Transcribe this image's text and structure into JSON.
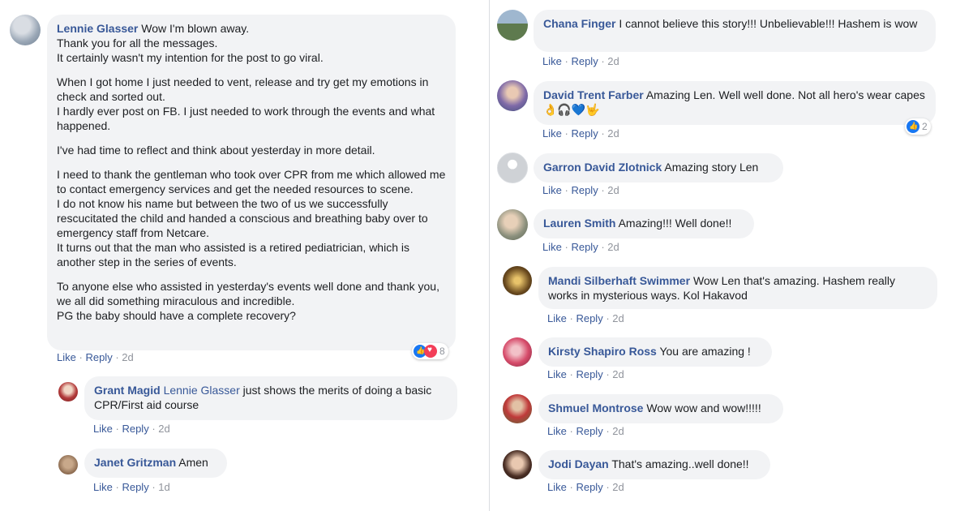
{
  "actions": {
    "like": "Like",
    "reply": "Reply",
    "sep": "·"
  },
  "main": {
    "author": "Lennie Glasser",
    "paragraphs": [
      "Wow I'm blown away.\nThank you for all the messages.\nIt certainly wasn't my intention for the post to go viral.",
      "When I got home I just needed to vent, release and try get my emotions in check and sorted out.\nI hardly ever post on FB. I just needed to work through the events and what happened.",
      "I've had time to reflect and think about yesterday in more detail.",
      "I need to thank the gentleman who took over CPR from me which allowed me to contact emergency services and get the needed resources to scene.\nI do not know his name but between the two of us we successfully rescucitated the child and handed a conscious and breathing baby over to emergency staff from Netcare.\nIt turns out that the man who assisted is a retired pediatrician, which is another step in the series of events.",
      "To anyone else who assisted in yesterday's events well done and thank you, we all did something miraculous and incredible.\nPG the baby should have a complete recovery?"
    ],
    "time": "2d",
    "reaction_count": "8"
  },
  "left_replies": [
    {
      "author": "Grant Magid",
      "mention": "Lennie Glasser",
      "text": "just shows the merits of doing a basic CPR/First aid course",
      "time": "2d"
    },
    {
      "author": "Janet Gritzman",
      "text": "Amen",
      "time": "1d"
    }
  ],
  "right_comments": [
    {
      "author": "Chana Finger",
      "text": "I cannot believe this story!!! Unbelievable!!! Hashem is wow",
      "time": "2d"
    },
    {
      "author": "David Trent Farber",
      "text": "Amazing Len. Well well done. Not all hero's wear capes 👌🎧💙🤟",
      "time": "2d",
      "reaction_count": "2"
    },
    {
      "author": "Garron David Zlotnick",
      "text": "Amazing story Len",
      "time": "2d"
    },
    {
      "author": "Lauren Smith",
      "text": "Amazing!!! Well done!!",
      "time": "2d"
    },
    {
      "author": "Mandi Silberhaft Swimmer",
      "text": "Wow Len that's amazing. Hashem really works in mysterious ways. Kol Hakavod",
      "time": "2d"
    },
    {
      "author": "Kirsty Shapiro Ross",
      "text": "You are amazing !",
      "time": "2d"
    },
    {
      "author": "Shmuel Montrose",
      "text": "Wow wow and wow!!!!!",
      "time": "2d"
    },
    {
      "author": "Jodi Dayan",
      "text": "That's amazing..well done!!",
      "time": "2d"
    }
  ],
  "colors": {
    "link": "#385898",
    "bubble": "#f2f3f5",
    "meta": "#90949c"
  }
}
